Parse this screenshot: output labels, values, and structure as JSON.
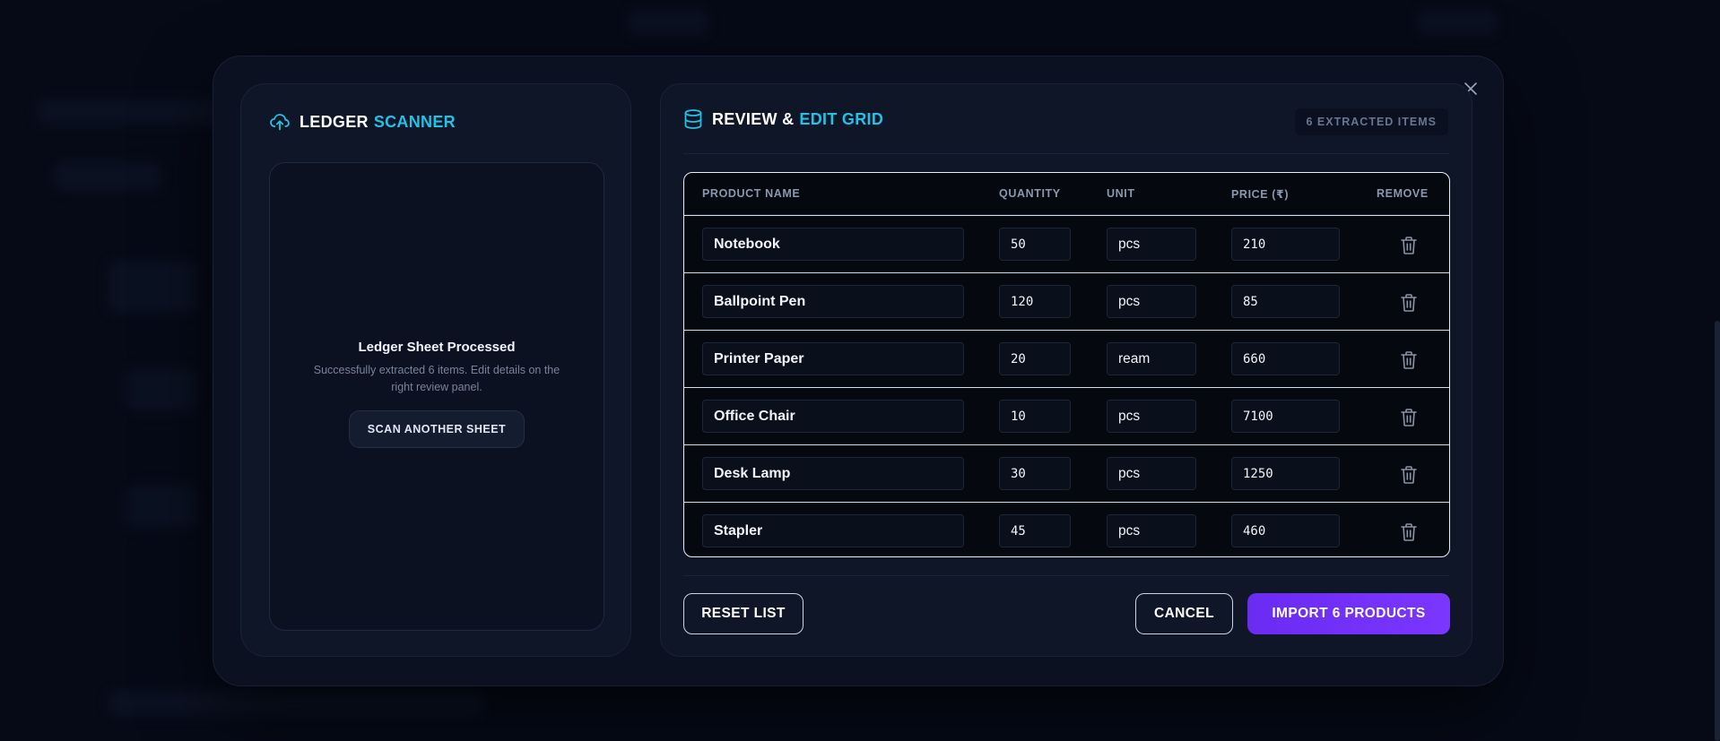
{
  "scanner": {
    "title_main": "LEDGER",
    "title_accent": "SCANNER",
    "icon": "cloud-upload-icon",
    "status_title": "Ledger Sheet Processed",
    "status_desc": "Successfully extracted 6 items. Edit details on the right review panel.",
    "scan_button": "SCAN ANOTHER SHEET"
  },
  "review": {
    "title_main": "REVIEW &",
    "title_accent": "EDIT GRID",
    "icon": "database-icon",
    "badge": "6 EXTRACTED ITEMS",
    "columns": {
      "name": "PRODUCT NAME",
      "quantity": "QUANTITY",
      "unit": "UNIT",
      "price": "PRICE (₹)",
      "remove": "REMOVE"
    },
    "rows": [
      {
        "name": "Notebook",
        "quantity": "50",
        "unit": "pcs",
        "price": "210"
      },
      {
        "name": "Ballpoint Pen",
        "quantity": "120",
        "unit": "pcs",
        "price": "85"
      },
      {
        "name": "Printer Paper",
        "quantity": "20",
        "unit": "ream",
        "price": "660"
      },
      {
        "name": "Office Chair",
        "quantity": "10",
        "unit": "pcs",
        "price": "7100"
      },
      {
        "name": "Desk Lamp",
        "quantity": "30",
        "unit": "pcs",
        "price": "1250"
      },
      {
        "name": "Stapler",
        "quantity": "45",
        "unit": "pcs",
        "price": "460"
      }
    ]
  },
  "footer": {
    "reset": "RESET LIST",
    "cancel": "CANCEL",
    "import": "IMPORT 6 PRODUCTS"
  },
  "colors": {
    "accent": "#22c1e6",
    "primary": "#6a2bf2",
    "background": "#060a17"
  }
}
